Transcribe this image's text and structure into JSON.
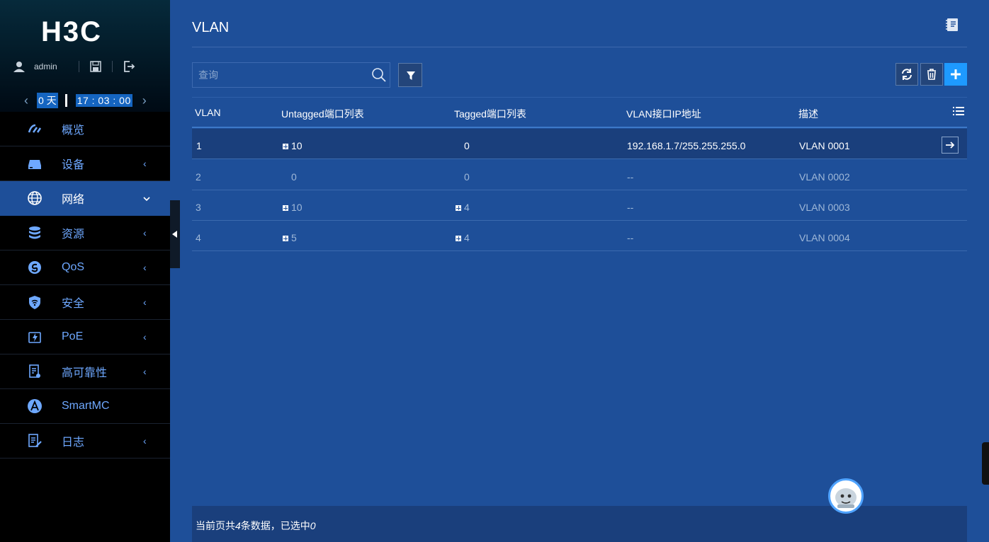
{
  "brand": {
    "logo_text": "H3C"
  },
  "user": {
    "name": "admin"
  },
  "uptime": {
    "days": "0 天",
    "clock": "17 : 03 : 00"
  },
  "menu": [
    {
      "label": "概览",
      "icon": "gauge-icon",
      "has_chevron": false,
      "chevron": ""
    },
    {
      "label": "设备",
      "icon": "device-icon",
      "has_chevron": true,
      "chevron": "‹"
    },
    {
      "label": "网络",
      "icon": "globe-icon",
      "has_chevron": true,
      "chevron": "⌄",
      "active": true
    },
    {
      "label": "资源",
      "icon": "database-icon",
      "has_chevron": true,
      "chevron": "‹"
    },
    {
      "label": "QoS",
      "icon": "qos-icon",
      "has_chevron": true,
      "chevron": "‹"
    },
    {
      "label": "安全",
      "icon": "shield-icon",
      "has_chevron": true,
      "chevron": "‹"
    },
    {
      "label": "PoE",
      "icon": "poe-icon",
      "has_chevron": true,
      "chevron": "‹"
    },
    {
      "label": "高可靠性",
      "icon": "reliability-icon",
      "has_chevron": true,
      "chevron": "‹"
    },
    {
      "label": "SmartMC",
      "icon": "smartmc-icon",
      "has_chevron": false,
      "chevron": ""
    },
    {
      "label": "日志",
      "icon": "log-icon",
      "has_chevron": true,
      "chevron": "‹"
    }
  ],
  "page": {
    "title": "VLAN"
  },
  "search": {
    "placeholder": "查询"
  },
  "table": {
    "headers": [
      "VLAN",
      "Untagged端口列表",
      "Tagged端口列表",
      "VLAN接口IP地址",
      "描述"
    ],
    "rows": [
      {
        "vlan": "1",
        "untagged": "10",
        "untagged_expand": true,
        "tagged": "0",
        "tagged_expand": false,
        "ip": "192.168.1.7/255.255.255.0",
        "desc": "VLAN 0001",
        "selected": true
      },
      {
        "vlan": "2",
        "untagged": "0",
        "untagged_expand": false,
        "tagged": "0",
        "tagged_expand": false,
        "ip": "--",
        "desc": "VLAN 0002",
        "selected": false
      },
      {
        "vlan": "3",
        "untagged": "10",
        "untagged_expand": true,
        "tagged": "4",
        "tagged_expand": true,
        "ip": "--",
        "desc": "VLAN 0003",
        "selected": false
      },
      {
        "vlan": "4",
        "untagged": "5",
        "untagged_expand": true,
        "tagged": "4",
        "tagged_expand": true,
        "ip": "--",
        "desc": "VLAN 0004",
        "selected": false
      }
    ]
  },
  "footer": {
    "prefix": "当前页共",
    "count": "4",
    "middle": "条数据，已选中",
    "selected": "0"
  },
  "colors": {
    "bg": "#1e4f99",
    "accent": "#1e9aff",
    "menu_text": "#6ea8ff"
  }
}
